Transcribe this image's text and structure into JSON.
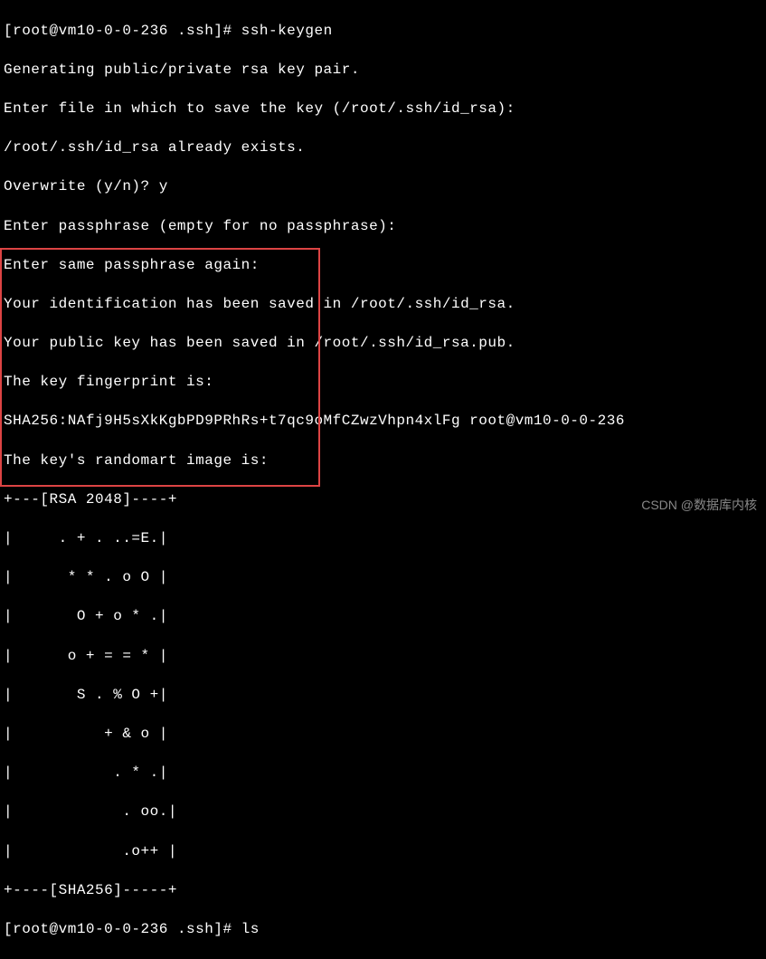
{
  "terminal": {
    "prompt1_open": "[",
    "prompt1_user": "root@vm10-0-0-236 .ssh",
    "prompt1_close": "]# ",
    "command1": "ssh-keygen",
    "line1": "Generating public/private rsa key pair.",
    "line2": "Enter file in which to save the key (/root/.ssh/id_rsa):",
    "line3": "/root/.ssh/id_rsa already exists.",
    "line4_prompt": "Overwrite (y/n)? ",
    "line4_input": "y",
    "line5": "Enter passphrase (empty for no passphrase):",
    "line6": "Enter same passphrase again:",
    "line7": "Your identification has been saved in /root/.ssh/id_rsa.",
    "line8": "Your public key has been saved in /root/.ssh/id_rsa.pub.",
    "line9": "The key fingerprint is:",
    "line10": "SHA256:NAfj9H5sXkKgbPD9PRhRs+t7qc9oMfCZwzVhpn4xlFg root@vm10-0-0-236",
    "line11": "The key's randomart image is:",
    "art1": "+---[RSA 2048]----+",
    "art2": "|     . + . ..=E.|",
    "art3": "|      * * . o O |",
    "art4": "|       O + o * .|",
    "art5": "|      o + = = * |",
    "art6": "|       S . % O +|",
    "art7": "|          + & o |",
    "art8": "|           . * .|",
    "art9": "|            . oo.|",
    "art10": "|            .o++ |",
    "art11": "+----[SHA256]-----+",
    "prompt2_open": "[",
    "prompt2_user": "root@vm10-0-0-236 .ssh",
    "prompt2_close": "]# ",
    "command2": "ls"
  },
  "watermark": "CSDN @数据库内核"
}
